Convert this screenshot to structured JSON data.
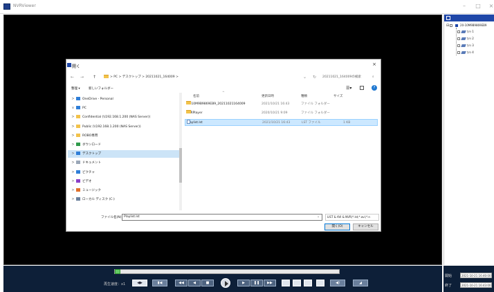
{
  "window": {
    "title": "NVRViewer",
    "minimize": "–",
    "maximize": "□",
    "close": "×"
  },
  "tree": {
    "root_label": "20-10M9B9869EB9",
    "channels": [
      "ｶﾒﾗ 1",
      "ｶﾒﾗ 2",
      "ｶﾒﾗ 3",
      "ｶﾒﾗ 4"
    ]
  },
  "dialog": {
    "title": "開く",
    "close": "×",
    "nav": {
      "back": "←",
      "forward": "→",
      "up": "↑"
    },
    "breadcrumb": "> PC > デスクトップ > 20211021_164009 >",
    "search_placeholder": "20211021_164009の検索",
    "toolbar": {
      "organize": "整理 ▾",
      "new_folder": "新しいフォルダー"
    },
    "sidebar": [
      {
        "label": "OneDrive - Personal",
        "icon": "cloud-icon",
        "color": "#2f7ed8",
        "chevron": ">",
        "indent": 0
      },
      {
        "label": "PC",
        "icon": "pc-icon",
        "color": "#2f7ed8",
        "chevron": "∨",
        "indent": 0
      },
      {
        "label": "Confidential (\\\\192.168.1.200 (NAS Server))",
        "icon": "folder-icon",
        "color": "#f2c24a",
        "chevron": ">",
        "indent": 1
      },
      {
        "label": "Public (\\\\192.168.1.200 (NAS Server))",
        "icon": "folder-icon",
        "color": "#f2c24a",
        "chevron": ">",
        "indent": 1
      },
      {
        "label": "ROBO専用",
        "icon": "folder-icon",
        "color": "#f2c24a",
        "chevron": ">",
        "indent": 1
      },
      {
        "label": "ダウンロード",
        "icon": "download-icon",
        "color": "#2f9a4a",
        "chevron": ">",
        "indent": 1
      },
      {
        "label": "デスクトップ",
        "icon": "desktop-icon",
        "color": "#2f7ed8",
        "chevron": ">",
        "indent": 1,
        "selected": true
      },
      {
        "label": "ドキュメント",
        "icon": "document-icon",
        "color": "#9aa7b8",
        "chevron": ">",
        "indent": 1
      },
      {
        "label": "ピクチャ",
        "icon": "picture-icon",
        "color": "#2f7ed8",
        "chevron": ">",
        "indent": 1
      },
      {
        "label": "ビデオ",
        "icon": "video-icon",
        "color": "#8a3fc8",
        "chevron": ">",
        "indent": 1
      },
      {
        "label": "ミュージック",
        "icon": "music-icon",
        "color": "#e0702a",
        "chevron": ">",
        "indent": 1
      },
      {
        "label": "ローカル ディスク (C:)",
        "icon": "disk-icon",
        "color": "#6a7f9c",
        "chevron": ">",
        "indent": 1
      }
    ],
    "columns": {
      "name": "名前",
      "date": "更新日時",
      "type": "種類",
      "size": "サイズ"
    },
    "files": [
      {
        "name": "20-10M9B9869EB9_20211021164009",
        "date": "2021/10/21 16:43",
        "type": "ファイル フォルダー",
        "size": "",
        "icon": "folder-icon"
      },
      {
        "name": "NVRPlayer",
        "date": "2020/10/21 9:09",
        "type": "ファイル フォルダー",
        "size": "",
        "icon": "folder-icon"
      },
      {
        "name": "Playlist.lst",
        "date": "2021/10/21 16:43",
        "type": "LST ファイル",
        "size": "1 KB",
        "icon": "file-icon",
        "selected": true
      }
    ],
    "filename_label": "ファイル名(N):",
    "filename_value": "Playlist.lst",
    "filetype": "LIST & AVI & NVR(*.lst;*.avi;*.n",
    "open_button": "開く(O)",
    "cancel_button": "キャンセル"
  },
  "controls": {
    "speed_label": "再生速度：x1",
    "progress_fraction": 0.0,
    "start_label": "開始",
    "end_label": "終了",
    "start_time": "2021-10-21 16:40:00",
    "end_time": "2021-10-21 16:43:00"
  },
  "colors": {
    "accent": "#1f47a8",
    "bottom_bar": "#0d1f38",
    "selection": "#cce4f7"
  }
}
